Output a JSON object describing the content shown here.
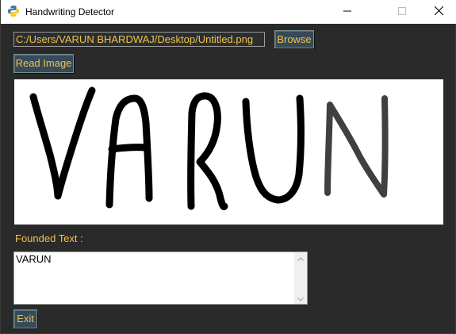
{
  "window": {
    "title": "Handwriting Detector",
    "icon": "python-feather-icon"
  },
  "controls": {
    "minimize_icon": "minimize-icon",
    "maximize_icon": "maximize-icon",
    "close_icon": "close-icon"
  },
  "file": {
    "path_value": "C:/Users/VARUN BHARDWAJ/Desktop/Untitled.png",
    "browse_label": "Browse",
    "read_label": "Read Image"
  },
  "canvas": {
    "drawn_text": "VARUN"
  },
  "output": {
    "label": "Founded Text :",
    "text": "VARUN"
  },
  "footer": {
    "exit_label": "Exit"
  },
  "colors": {
    "background": "#2a2a2a",
    "accent_text": "#f0c24a",
    "button_bg": "#364a58"
  }
}
